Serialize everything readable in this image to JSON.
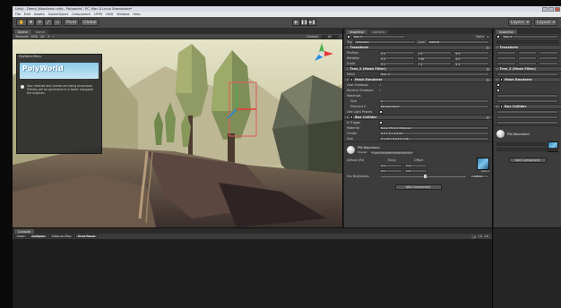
{
  "window": {
    "title": "Unity - Demo_Woodland.unity - Polyworld - PC, Mac & Linux Standalone*"
  },
  "menu": [
    "File",
    "Edit",
    "Assets",
    "GameObject",
    "Component",
    "UFPS",
    "HUD",
    "Window",
    "Help"
  ],
  "toolbar": {
    "tools": [
      "✋",
      "✥",
      "⟳",
      "⤢",
      "▭"
    ],
    "pivot": "Pivot",
    "global": "Global",
    "play": "▶",
    "pause": "❚❚",
    "step": "▶❚",
    "layers": "Layers",
    "layout": "Layout"
  },
  "scene": {
    "tabs": [
      "Scene",
      "Game"
    ],
    "shading": "Textured",
    "mode": "RGB",
    "view2d": "2D",
    "gizmos": "Gizmos",
    "search_placeholder": "All",
    "persp_label": "Persp",
    "overlay": {
      "header": "PolyWorld Menu",
      "logo": "PolyWorld",
      "text": "Your meshes and scenes are being processed. Prefabs will be generated in a folder alongside the originals."
    }
  },
  "inspector_left": {
    "tabs": [
      "Inspector",
      "Lighting"
    ],
    "object_name": "Tree_2",
    "static_label": "Static",
    "tag_label": "Tag",
    "tag_value": "Untagged",
    "layer_label": "Layer",
    "layer_value": "Default",
    "transform": {
      "title": "Transform",
      "rows": [
        {
          "label": "Position",
          "x": "X 0",
          "y": "Y 0",
          "z": "Z 0"
        },
        {
          "label": "Rotation",
          "x": "X 0",
          "y": "Y 90",
          "z": "Z 0"
        },
        {
          "label": "Scale",
          "x": "X 1",
          "y": "Y 1",
          "z": "Z 1"
        }
      ]
    },
    "mesh_filter": {
      "title": "Tree_2 (Mesh Filter)",
      "mesh_label": "Mesh",
      "mesh_value": "Tree_2"
    },
    "mesh_renderer": {
      "title": "Mesh Renderer",
      "rows": [
        {
          "label": "Cast Shadows",
          "value": "✓"
        },
        {
          "label": "Receive Shadows",
          "value": "✓"
        },
        {
          "label": "Materials",
          "value": ""
        },
        {
          "label": "Size",
          "value": "1"
        },
        {
          "label": "Element 0",
          "value": "PW-Woodland"
        },
        {
          "label": "Use Light Probes",
          "value": ""
        },
        {
          "label": "Anchor Override",
          "value": "None (Transform)"
        }
      ]
    },
    "box_collider": {
      "title": "Box Collider",
      "rows": [
        {
          "label": "Is Trigger",
          "value": ""
        },
        {
          "label": "Material",
          "value": "None (Physic Material)"
        },
        {
          "label": "Center",
          "value": "X 0   Y 4.1   Z 0.05"
        },
        {
          "label": "Size",
          "value": "X 1.03   Y 8.23   Z 1.36"
        }
      ]
    },
    "material": {
      "name": "PW-Woodland",
      "shader_label": "Shader",
      "shader_value": "Custom/PolyWorld/VertexColor",
      "diffuse_label": "Diffuse (Rt)",
      "tiling": "Tiling",
      "offset": "Offset",
      "tiling_x": "x 1",
      "tiling_y": "y 1",
      "offset_x": "x 0",
      "offset_y": "y 0",
      "brightness_label": "Vtx Brightness",
      "brightness_value": "1.08544",
      "select_label": "Select"
    },
    "add_component": "Add Component"
  },
  "inspector_right": {
    "tabs": [
      "Inspector"
    ],
    "object_name": "Tree_2",
    "transform_title": "Transform",
    "mesh_filter_title": "Tree_2 (Mesh Filter)",
    "mesh_renderer_title": "Mesh Renderer",
    "box_collider_title": "Box Collider",
    "material_name": "PW-Woodland",
    "add_component": "Add Component"
  },
  "console": {
    "tabs": [
      "Console"
    ],
    "buttons": [
      "Clear",
      "Collapse",
      "Clear on Play",
      "Error Pause"
    ],
    "counts": [
      "0",
      "0",
      "0"
    ]
  }
}
